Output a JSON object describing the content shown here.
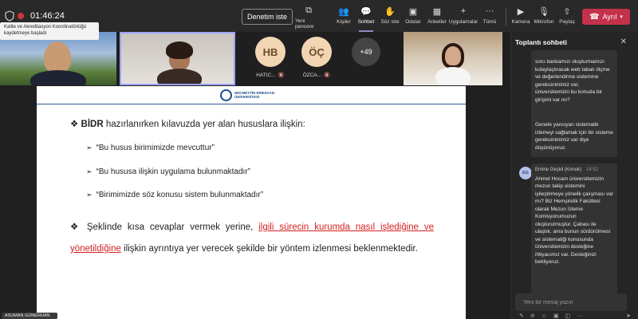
{
  "topbar": {
    "timer": "01:46:24",
    "recording_banner": "Kalite ve Akreditasyon Koordinatörlüğü kaydetmeye başladı",
    "present_label": "Denetim iste",
    "buttons": [
      {
        "label": "Yeni pencere",
        "icon": "new-window-icon"
      },
      {
        "label": "Kişiler",
        "icon": "people-icon"
      },
      {
        "label": "Sohbet",
        "icon": "chat-icon"
      },
      {
        "label": "Söz iste",
        "icon": "raise-hand-icon"
      },
      {
        "label": "Odalar",
        "icon": "rooms-icon"
      },
      {
        "label": "Anketler",
        "icon": "polls-icon"
      },
      {
        "label": "Uygulamalar",
        "icon": "apps-icon"
      },
      {
        "label": "Tümü",
        "icon": "more-icon"
      },
      {
        "label": "Kamera",
        "icon": "camera-icon"
      },
      {
        "label": "Mikrofon",
        "icon": "mic-off-icon"
      },
      {
        "label": "Paylaş",
        "icon": "share-icon"
      }
    ],
    "leave_label": "Ayrıl"
  },
  "participants": {
    "avatar1": {
      "initials": "HB",
      "name": "HATIC..."
    },
    "avatar2": {
      "initials": "ÖÇ",
      "name": "ÖZCA..."
    },
    "more": "+49"
  },
  "slide": {
    "logo_text": "NECMETTİN ERBAKAN ÜNİVERSİTESİ",
    "bullet1_bold": "BİDR",
    "bullet1_rest": " hazırlanırken kılavuzda yer alan hususlara ilişkin:",
    "sub_items": [
      "“Bu husus birimimizde mevcuttur”",
      "“Bu hususa ilişkin uygulama bulunmaktadır”",
      "“Birimimizde söz konusu sistem bulunmaktadır”"
    ],
    "para_start": "Şeklinde kısa cevaplar vermek yerine, ",
    "para_red1": "ilgili sürecin kurumda nasıl işlediğine ve",
    "para_red2": "yönetildiğine",
    "para_end": " ilişkin ayrıntıya yer verecek şekilde bir yöntem izlenmesi beklenmektedir."
  },
  "presenter_name": "ASUMAN GÜNERHAN",
  "chat": {
    "title": "Toplantı sohbeti",
    "msg1": "soru bankamızı oluşturmamızı kolaylaştıracak web tabalı ölçme ve değerlendirme sistemine gereksinimimiz var, üniversitemizin bu konuda bir girişimi var mı?",
    "msg2": "Genele yansıyan sistematik izlemeyi sağlamak için bir sisteme gereksinimimiz var diye düşünüyoruz.",
    "msg3_avatar": "EG",
    "msg3_sender": "Emine Geçkil (Konuk)",
    "msg3_time": "14:52",
    "msg3": "Ahmet Hocam üniversitemizin mezun takip sistemini iyileştirmeye yönelik çalışması var mı? Biz Hemşirelik Fakültesi olarak Mezun İzleme Komisyonumuzun oluşturulmuştur. Çabası ile ulaştık, ama bunun sürdürülmesi ve sistematiği konusunda üniversitemizin desteğine ihtiyacımız var. Desteğinizi bekliyoruz.",
    "compose_placeholder": "Yeni bir mesaj yazın"
  }
}
